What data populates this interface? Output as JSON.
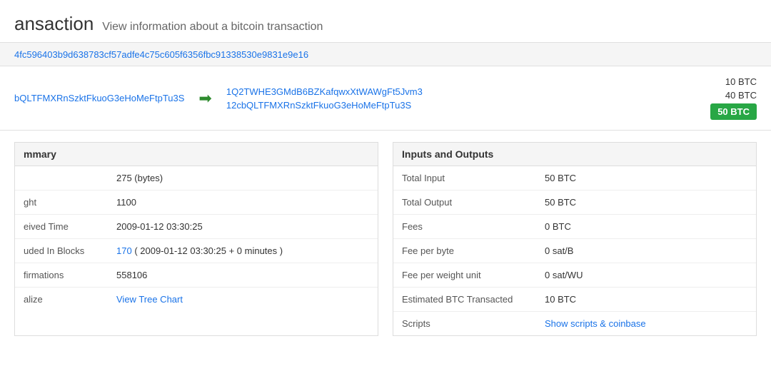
{
  "page": {
    "title": "ansaction",
    "subtitle": "View information about a bitcoin transaction"
  },
  "tx": {
    "hash": "4fc596403b9d638783cf57adfe4c75c605f6356fbc91338530e9831e9e16",
    "from": [
      {
        "address": "bQLTFMXRnSzktFkuoG3eHoMeFtpTu3S",
        "label": "from-address-1"
      }
    ],
    "to": [
      {
        "address": "1Q2TWHE3GMdB6BZKafqwxXtWAWgFt5Jvm3",
        "amount": "10 BTC"
      },
      {
        "address": "12cbQLTFMXRnSzktFkuoG3eHoMeFtpTu3S",
        "amount": "40 BTC"
      }
    ],
    "total_badge": "50 BTC"
  },
  "summary": {
    "title": "mmary",
    "rows": [
      {
        "label": "",
        "value": "275 (bytes)"
      },
      {
        "label": "ght",
        "value": "1100"
      },
      {
        "label": "eived Time",
        "value": "2009-01-12 03:30:25"
      },
      {
        "label": "uded In Blocks",
        "value_link": "170",
        "value_suffix": " ( 2009-01-12 03:30:25 + 0 minutes )"
      },
      {
        "label": "firmations",
        "value": "558106"
      },
      {
        "label": "alize",
        "value_link": "View Tree Chart",
        "value_link_url": "#"
      }
    ]
  },
  "inputs_outputs": {
    "title": "Inputs and Outputs",
    "rows": [
      {
        "label": "Total Input",
        "value": "50 BTC"
      },
      {
        "label": "Total Output",
        "value": "50 BTC"
      },
      {
        "label": "Fees",
        "value": "0 BTC"
      },
      {
        "label": "Fee per byte",
        "value": "0 sat/B"
      },
      {
        "label": "Fee per weight unit",
        "value": "0 sat/WU"
      },
      {
        "label": "Estimated BTC Transacted",
        "value": "10 BTC"
      },
      {
        "label": "Scripts",
        "value_link": "Show scripts & coinbase"
      }
    ]
  }
}
